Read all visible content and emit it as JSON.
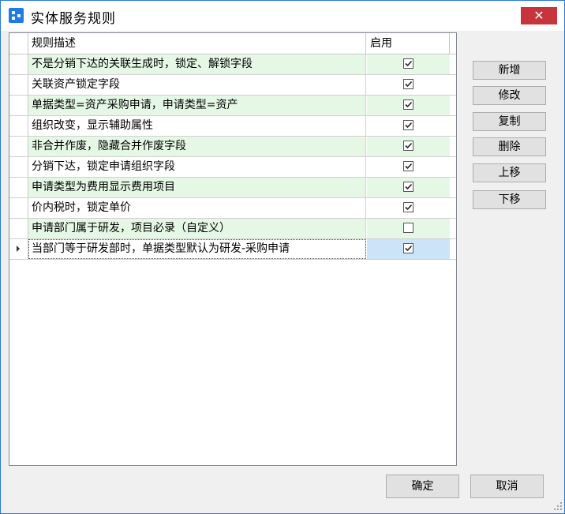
{
  "window": {
    "title": "实体服务规则"
  },
  "titlebar": {
    "close_glyph": "✕"
  },
  "grid": {
    "columns": [
      "规则描述",
      "启用"
    ],
    "rows": [
      {
        "description": "不是分销下达的关联生成时，锁定、解锁字段",
        "enabled": true
      },
      {
        "description": "关联资产锁定字段",
        "enabled": true
      },
      {
        "description": "单据类型=资产采购申请，申请类型=资产",
        "enabled": true
      },
      {
        "description": "组织改变，显示辅助属性",
        "enabled": true
      },
      {
        "description": "非合并作废，隐藏合并作废字段",
        "enabled": true
      },
      {
        "description": "分销下达，锁定申请组织字段",
        "enabled": true
      },
      {
        "description": "申请类型为费用显示费用项目",
        "enabled": true
      },
      {
        "description": "价内税时，锁定单价",
        "enabled": true
      },
      {
        "description": "申请部门属于研发，项目必录（自定义）",
        "enabled": false
      },
      {
        "description": "当部门等于研发部时，单据类型默认为研发-采购申请",
        "enabled": true
      }
    ],
    "selected_row": 9
  },
  "side_buttons": {
    "add": "新增",
    "edit": "修改",
    "copy": "复制",
    "delete": "删除",
    "move_up": "上移",
    "move_down": "下移"
  },
  "footer": {
    "ok": "确定",
    "cancel": "取消"
  },
  "colors": {
    "accent": "#1e7be3",
    "close": "#c7343b",
    "alt_row": "#e5f8e5",
    "selected_cell": "#cce4f7"
  }
}
